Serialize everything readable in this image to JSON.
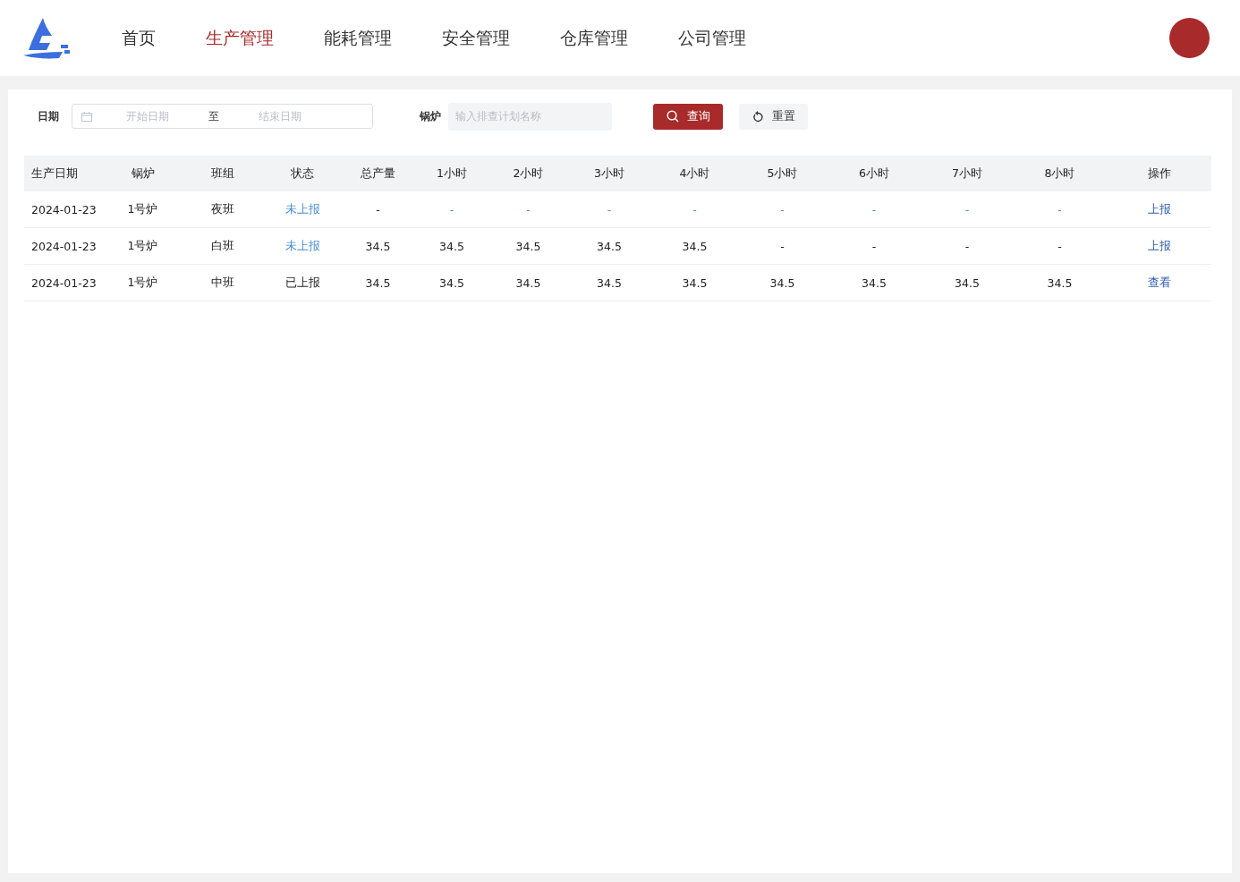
{
  "nav": {
    "items": [
      {
        "label": "首页",
        "selected": false
      },
      {
        "label": "生产管理",
        "selected": true
      },
      {
        "label": "能耗管理",
        "selected": false
      },
      {
        "label": "安全管理",
        "selected": false
      },
      {
        "label": "仓库管理",
        "selected": false
      },
      {
        "label": "公司管理",
        "selected": false
      }
    ]
  },
  "filters": {
    "date_label": "日期",
    "start_placeholder": "开始日期",
    "separator": "至",
    "end_placeholder": "结束日期",
    "boiler_label": "锅炉",
    "boiler_placeholder": "输入排查计划名称",
    "search_button": "查询",
    "reset_button": "重置"
  },
  "table": {
    "columns": [
      "生产日期",
      "锅炉",
      "班组",
      "状态",
      "总产量",
      "1小时",
      "2小时",
      "3小时",
      "4小时",
      "5小时",
      "6小时",
      "7小时",
      "8小时",
      "操作"
    ],
    "rows": [
      {
        "cells": [
          {
            "text": "2024-01-23",
            "kind": "text"
          },
          {
            "text": "1号炉",
            "kind": "text"
          },
          {
            "text": "夜班",
            "kind": "text"
          },
          {
            "text": "未上报",
            "kind": "link"
          },
          {
            "text": "-",
            "kind": "text"
          },
          {
            "text": "-",
            "kind": "link"
          },
          {
            "text": "-",
            "kind": "link"
          },
          {
            "text": "-",
            "kind": "link"
          },
          {
            "text": "-",
            "kind": "link"
          },
          {
            "text": "-",
            "kind": "link"
          },
          {
            "text": "-",
            "kind": "link"
          },
          {
            "text": "-",
            "kind": "link"
          },
          {
            "text": "-",
            "kind": "link"
          },
          {
            "text": "上报",
            "kind": "action"
          }
        ]
      },
      {
        "cells": [
          {
            "text": "2024-01-23",
            "kind": "text"
          },
          {
            "text": "1号炉",
            "kind": "text"
          },
          {
            "text": "白班",
            "kind": "text"
          },
          {
            "text": "未上报",
            "kind": "link"
          },
          {
            "text": "34.5",
            "kind": "text"
          },
          {
            "text": "34.5",
            "kind": "text"
          },
          {
            "text": "34.5",
            "kind": "text"
          },
          {
            "text": "34.5",
            "kind": "text"
          },
          {
            "text": "34.5",
            "kind": "text"
          },
          {
            "text": "-",
            "kind": "text"
          },
          {
            "text": "-",
            "kind": "text"
          },
          {
            "text": "-",
            "kind": "text"
          },
          {
            "text": "-",
            "kind": "text"
          },
          {
            "text": "上报",
            "kind": "action"
          }
        ]
      },
      {
        "cells": [
          {
            "text": "2024-01-23",
            "kind": "text"
          },
          {
            "text": "1号炉",
            "kind": "text"
          },
          {
            "text": "中班",
            "kind": "text"
          },
          {
            "text": "已上报",
            "kind": "text"
          },
          {
            "text": "34.5",
            "kind": "text"
          },
          {
            "text": "34.5",
            "kind": "text"
          },
          {
            "text": "34.5",
            "kind": "text"
          },
          {
            "text": "34.5",
            "kind": "text"
          },
          {
            "text": "34.5",
            "kind": "text"
          },
          {
            "text": "34.5",
            "kind": "text"
          },
          {
            "text": "34.5",
            "kind": "text"
          },
          {
            "text": "34.5",
            "kind": "text"
          },
          {
            "text": "34.5",
            "kind": "text"
          },
          {
            "text": "查看",
            "kind": "action"
          }
        ]
      }
    ]
  }
}
